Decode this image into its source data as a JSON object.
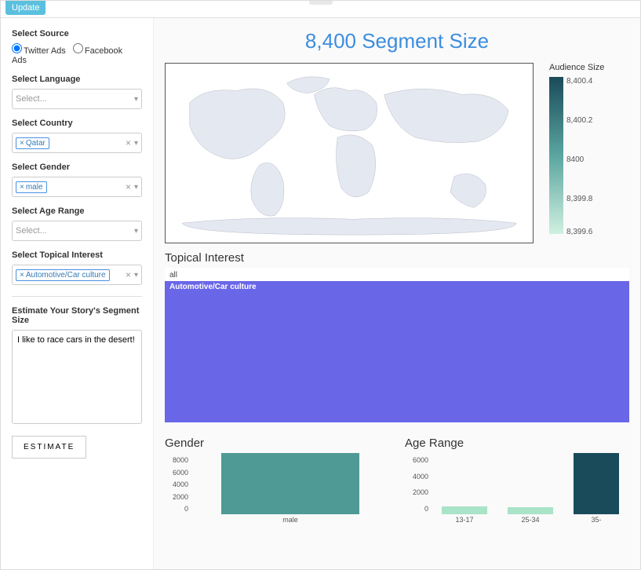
{
  "topbar": {
    "update": "Update"
  },
  "sidebar": {
    "source_label": "Select Source",
    "source_options": {
      "twitter": "Twitter Ads",
      "facebook": "Facebook Ads"
    },
    "source_selected": "twitter",
    "language_label": "Select Language",
    "language_placeholder": "Select...",
    "country_label": "Select Country",
    "country_selected": [
      "Qatar"
    ],
    "gender_label": "Select Gender",
    "gender_selected": [
      "male"
    ],
    "age_label": "Select Age Range",
    "age_placeholder": "Select...",
    "topic_label": "Select Topical Interest",
    "topic_selected": [
      "Automotive/Car culture"
    ],
    "estimate_label": "Estimate Your Story's Segment Size",
    "estimate_text": "I like to race cars in the desert!",
    "estimate_btn": "ESTIMATE"
  },
  "content": {
    "segment_title": "8,400 Segment Size",
    "legend_title": "Audience Size",
    "legend_ticks": [
      "8,400.4",
      "8,400.2",
      "8400",
      "8,399.8",
      "8,399.6"
    ],
    "topical_title": "Topical Interest",
    "topical_all": "all",
    "topical_bar_label": "Automotive/Car culture",
    "gender_title": "Gender",
    "age_title": "Age Range"
  },
  "chart_data": [
    {
      "type": "choropleth",
      "title": "Audience Size",
      "countries": [
        "Qatar"
      ],
      "values": [
        8400
      ],
      "colorbar_range": [
        8399.6,
        8400.4
      ]
    },
    {
      "type": "bar",
      "title": "Topical Interest",
      "orientation": "horizontal",
      "categories": [
        "Automotive/Car culture"
      ],
      "values": [
        8400
      ],
      "parent": "all"
    },
    {
      "type": "bar",
      "title": "Gender",
      "categories": [
        "male"
      ],
      "values": [
        8000
      ],
      "y_ticks": [
        0,
        2000,
        4000,
        6000,
        8000
      ],
      "ylim": [
        0,
        8000
      ],
      "colors": [
        "#4f9a94"
      ]
    },
    {
      "type": "bar",
      "title": "Age Range",
      "categories": [
        "13-17",
        "25-34",
        "35-"
      ],
      "values": [
        800,
        700,
        6000
      ],
      "y_ticks": [
        0,
        2000,
        4000,
        6000
      ],
      "ylim": [
        0,
        6000
      ],
      "colors": [
        "#a9e3c8",
        "#a9e3c8",
        "#1a4b5a"
      ]
    }
  ]
}
